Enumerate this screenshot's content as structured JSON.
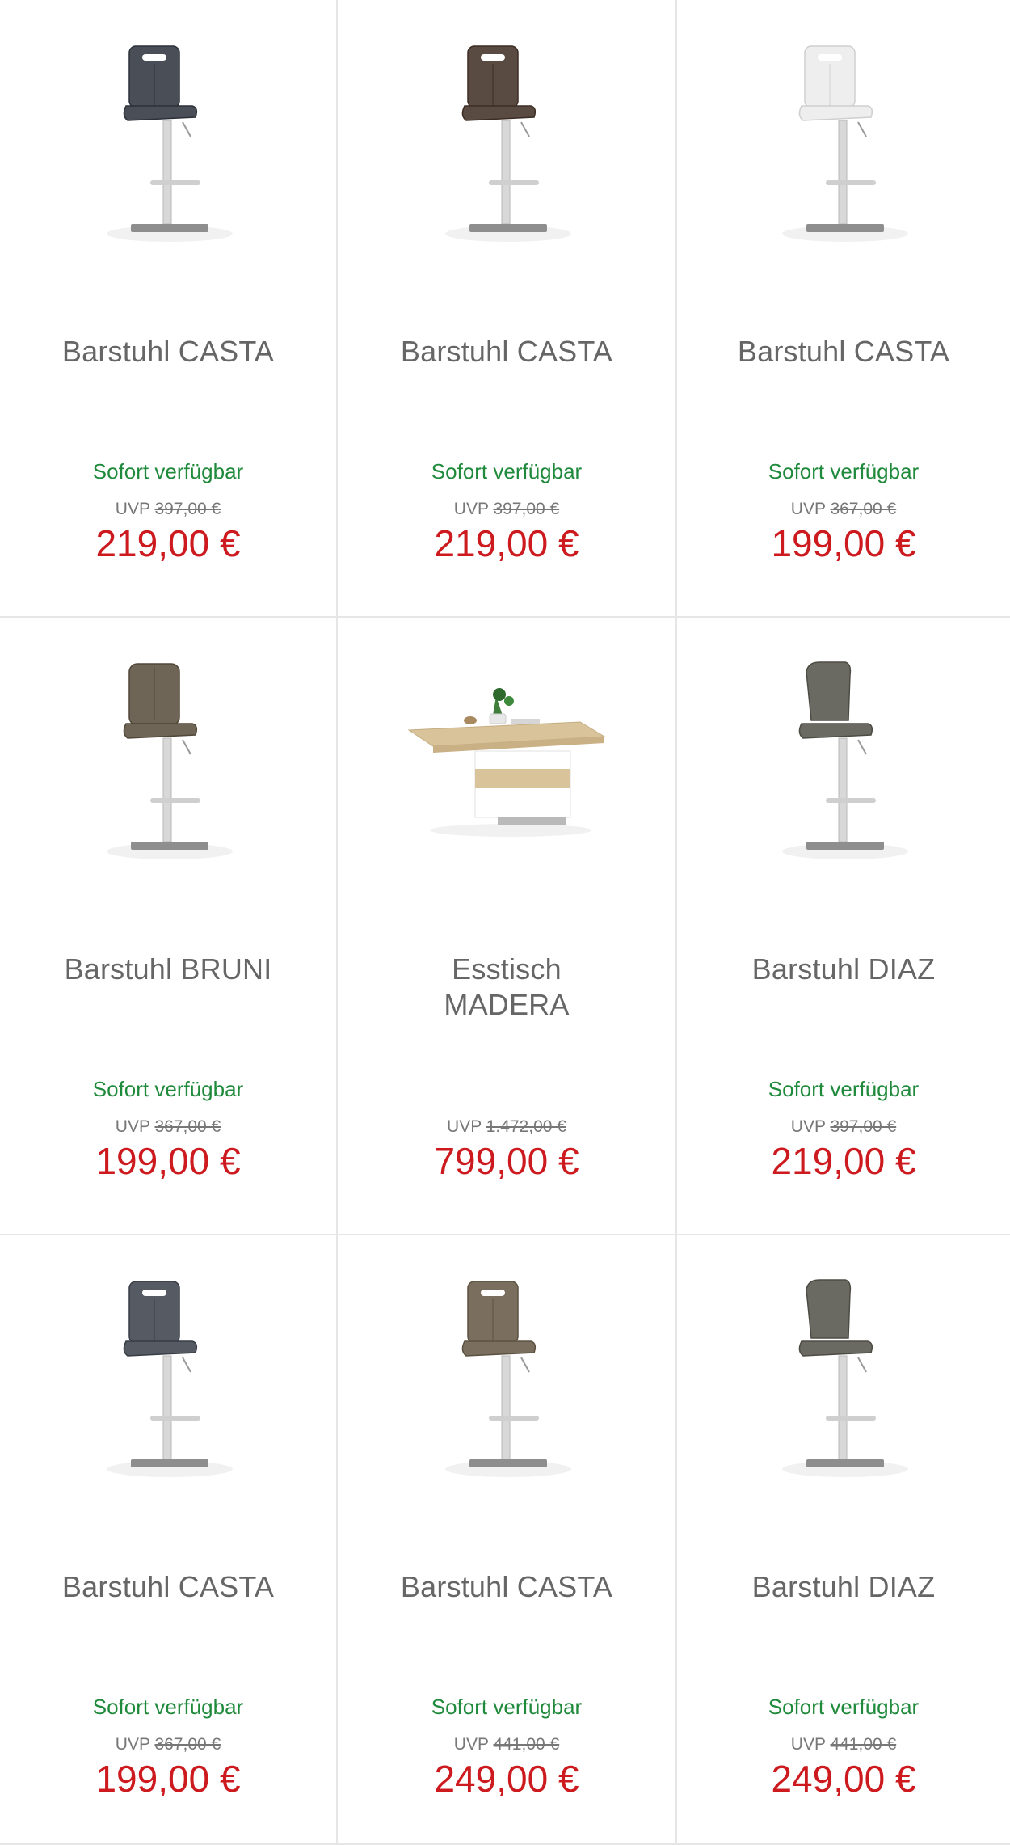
{
  "products": [
    {
      "name": "Barstuhl CASTA",
      "availability": "Sofort verfügbar",
      "uvp_label": "UVP",
      "uvp_price": "397,00 €",
      "price": "219,00 €",
      "image": "bar-stool-handle",
      "color": "#4a4f57"
    },
    {
      "name": "Barstuhl CASTA",
      "availability": "Sofort verfügbar",
      "uvp_label": "UVP",
      "uvp_price": "397,00 €",
      "price": "219,00 €",
      "image": "bar-stool-handle",
      "color": "#5a4b42"
    },
    {
      "name": "Barstuhl CASTA",
      "availability": "Sofort verfügbar",
      "uvp_label": "UVP",
      "uvp_price": "367,00 €",
      "price": "199,00 €",
      "image": "bar-stool-handle",
      "color": "#eeeeee"
    },
    {
      "name": "Barstuhl BRUNI",
      "availability": "Sofort verfügbar",
      "uvp_label": "UVP",
      "uvp_price": "367,00 €",
      "price": "199,00 €",
      "image": "bar-stool-plain",
      "color": "#6e6556"
    },
    {
      "name": "Esstisch MADERA",
      "availability": "",
      "uvp_label": "UVP",
      "uvp_price": "1.472,00 €",
      "price": "799,00 €",
      "image": "dining-table",
      "color": "#d8c39b"
    },
    {
      "name": "Barstuhl DIAZ",
      "availability": "Sofort verfügbar",
      "uvp_label": "UVP",
      "uvp_price": "397,00 €",
      "price": "219,00 €",
      "image": "bar-stool-curved",
      "color": "#6b6a62"
    },
    {
      "name": "Barstuhl CASTA",
      "availability": "Sofort verfügbar",
      "uvp_label": "UVP",
      "uvp_price": "367,00 €",
      "price": "199,00 €",
      "image": "bar-stool-handle",
      "color": "#555a63"
    },
    {
      "name": "Barstuhl CASTA",
      "availability": "Sofort verfügbar",
      "uvp_label": "UVP",
      "uvp_price": "441,00 €",
      "price": "249,00 €",
      "image": "bar-stool-handle",
      "color": "#7a6e5e"
    },
    {
      "name": "Barstuhl DIAZ",
      "availability": "Sofort verfügbar",
      "uvp_label": "UVP",
      "uvp_price": "441,00 €",
      "price": "249,00 €",
      "image": "bar-stool-curved",
      "color": "#6b6a62"
    }
  ]
}
